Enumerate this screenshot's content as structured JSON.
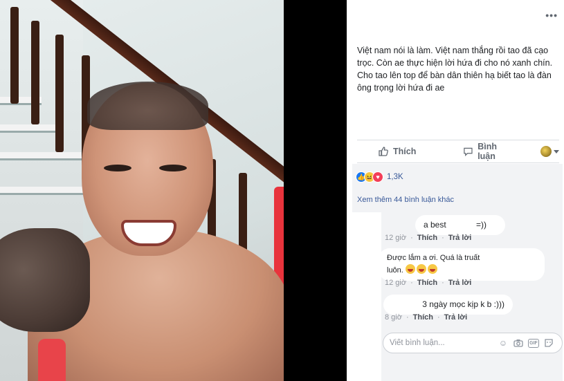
{
  "post": {
    "more_label": "•••",
    "caption": "Việt nam nói là làm. Việt nam thắng rồi tao đã cạo trọc. Còn ae thực hiện lời hứa đi cho nó xanh chín. Cho tao lên top để bàn dân thiên hạ biết tao là đàn ông trọng lời hứa đi ae"
  },
  "actions": {
    "like_label": "Thích",
    "comment_label": "Bình luận"
  },
  "reactions": {
    "count": "1,3K",
    "types": [
      "like",
      "haha",
      "love"
    ]
  },
  "comments_header": {
    "view_more": "Xem thêm 44 bình luận khác"
  },
  "comments": [
    {
      "text": "a best             =))",
      "time": "12 giờ",
      "like": "Thích",
      "reply": "Trả lời"
    },
    {
      "text_line1": "Được lắm a ơi. Quá là truất",
      "text_line2": "luôn.",
      "time": "12 giờ",
      "like": "Thích",
      "reply": "Trả lời"
    },
    {
      "text": "3 ngày mọc kịp k b :)))",
      "time": "8 giờ",
      "like": "Thích",
      "reply": "Trả lời"
    }
  ],
  "composer": {
    "placeholder": "Viết bình luận..."
  },
  "icons": [
    "like-icon",
    "comment-icon",
    "emoji-icon",
    "camera-icon",
    "gif-icon",
    "sticker-icon"
  ],
  "colors": {
    "link": "#385898",
    "like_blue": "#1877f2",
    "love_red": "#f33e58"
  }
}
